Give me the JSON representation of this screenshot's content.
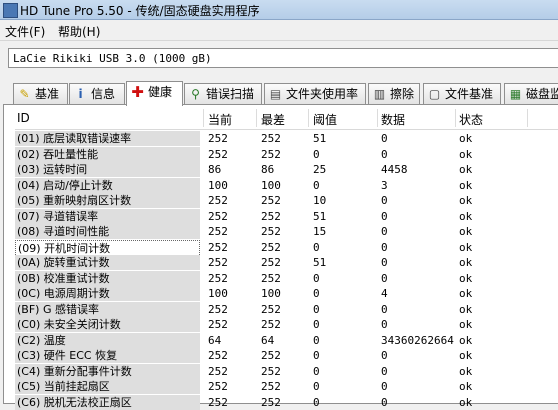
{
  "window": {
    "title": "HD Tune Pro 5.50 - 传统/固态硬盘实用程序"
  },
  "menu": {
    "file": "文件(F)",
    "help": "帮助(H)"
  },
  "drive": {
    "selected": "LaCie  Rikiki USB 3.0 (1000 gB)"
  },
  "tabs": [
    {
      "label": "基准",
      "icon": "benchmark-icon"
    },
    {
      "label": "信息",
      "icon": "info-icon"
    },
    {
      "label": "健康",
      "icon": "health-cross-icon",
      "active": true
    },
    {
      "label": "错误扫描",
      "icon": "magnifier-icon"
    },
    {
      "label": "文件夹使用率",
      "icon": "folder-icon"
    },
    {
      "label": "擦除",
      "icon": "trash-icon"
    },
    {
      "label": "文件基准",
      "icon": "file-benchmark-icon"
    },
    {
      "label": "磁盘监",
      "icon": "disk-monitor-icon"
    }
  ],
  "table": {
    "headers": {
      "id": "ID",
      "current": "当前",
      "worst": "最差",
      "threshold": "阈值",
      "data": "数据",
      "status": "状态"
    },
    "rows": [
      {
        "id": "(01) 底层读取错误速率",
        "current": "252",
        "worst": "252",
        "threshold": "51",
        "data": "0",
        "status": "ok"
      },
      {
        "id": "(02) 吞吐量性能",
        "current": "252",
        "worst": "252",
        "threshold": "0",
        "data": "0",
        "status": "ok"
      },
      {
        "id": "(03) 运转时间",
        "current": "86",
        "worst": "86",
        "threshold": "25",
        "data": "4458",
        "status": "ok"
      },
      {
        "id": "(04) 启动/停止计数",
        "current": "100",
        "worst": "100",
        "threshold": "0",
        "data": "3",
        "status": "ok"
      },
      {
        "id": "(05) 重新映射扇区计数",
        "current": "252",
        "worst": "252",
        "threshold": "10",
        "data": "0",
        "status": "ok"
      },
      {
        "id": "(07) 寻道错误率",
        "current": "252",
        "worst": "252",
        "threshold": "51",
        "data": "0",
        "status": "ok"
      },
      {
        "id": "(08) 寻道时间性能",
        "current": "252",
        "worst": "252",
        "threshold": "15",
        "data": "0",
        "status": "ok"
      },
      {
        "id": "(09) 开机时间计数",
        "current": "252",
        "worst": "252",
        "threshold": "0",
        "data": "0",
        "status": "ok",
        "selected": true
      },
      {
        "id": "(0A) 旋转重试计数",
        "current": "252",
        "worst": "252",
        "threshold": "51",
        "data": "0",
        "status": "ok"
      },
      {
        "id": "(0B) 校准重试计数",
        "current": "252",
        "worst": "252",
        "threshold": "0",
        "data": "0",
        "status": "ok"
      },
      {
        "id": "(0C) 电源周期计数",
        "current": "100",
        "worst": "100",
        "threshold": "0",
        "data": "4",
        "status": "ok"
      },
      {
        "id": "(BF) G 感错误率",
        "current": "252",
        "worst": "252",
        "threshold": "0",
        "data": "0",
        "status": "ok"
      },
      {
        "id": "(C0) 未安全关闭计数",
        "current": "252",
        "worst": "252",
        "threshold": "0",
        "data": "0",
        "status": "ok"
      },
      {
        "id": "(C2) 温度",
        "current": "64",
        "worst": "64",
        "threshold": "0",
        "data": "34360262664",
        "status": "ok"
      },
      {
        "id": "(C3) 硬件 ECC 恢复",
        "current": "252",
        "worst": "252",
        "threshold": "0",
        "data": "0",
        "status": "ok"
      },
      {
        "id": "(C4) 重新分配事件计数",
        "current": "252",
        "worst": "252",
        "threshold": "0",
        "data": "0",
        "status": "ok"
      },
      {
        "id": "(C5) 当前挂起扇区",
        "current": "252",
        "worst": "252",
        "threshold": "0",
        "data": "0",
        "status": "ok"
      },
      {
        "id": "(C6) 脱机无法校正扇区",
        "current": "252",
        "worst": "252",
        "threshold": "0",
        "data": "0",
        "status": "ok"
      }
    ]
  }
}
